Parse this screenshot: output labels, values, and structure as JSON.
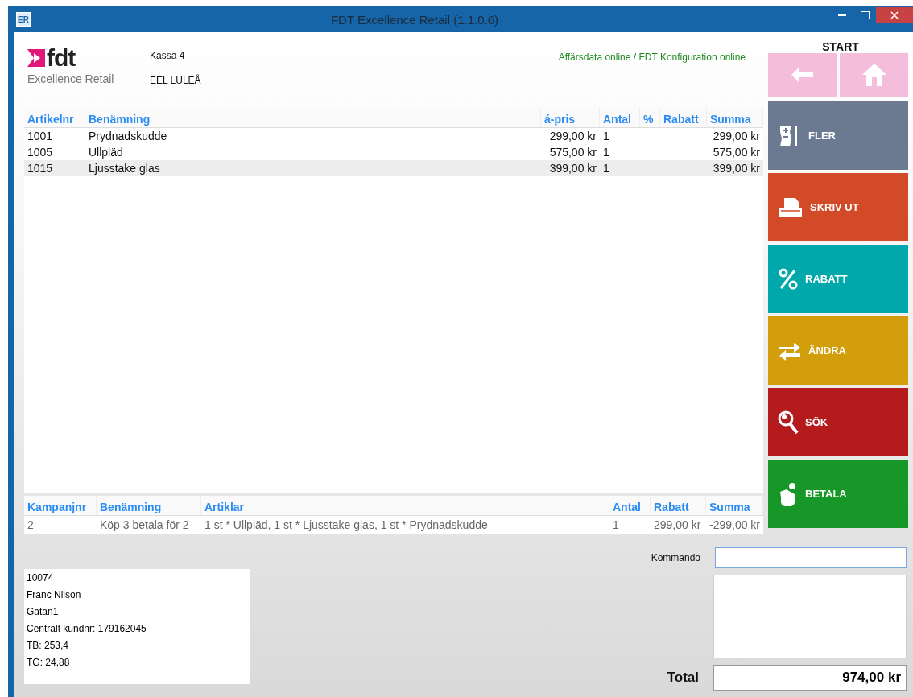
{
  "window": {
    "app_icon": "ER",
    "title": "FDT Excellence Retail (1.1.0.6)"
  },
  "header": {
    "logo": {
      "name": "fdt",
      "tagline": "Excellence Retail"
    },
    "register": "Kassa 4",
    "store": "EEL LULEÅ",
    "status": "Affärsdata online / FDT Konfiguration online"
  },
  "nav": {
    "title": "START",
    "buttons": [
      {
        "kind": "back"
      },
      {
        "kind": "home"
      }
    ]
  },
  "items": {
    "columns": [
      "Artikelnr",
      "Benämning",
      "á-pris",
      "Antal",
      "%",
      "Rabatt",
      "Summa"
    ],
    "rows": [
      {
        "selected": false,
        "cells": [
          "1001",
          "Prydnadskudde",
          "299,00 kr",
          "1",
          "",
          "",
          "299,00 kr"
        ]
      },
      {
        "selected": false,
        "cells": [
          "1005",
          "Ullpläd",
          "575,00 kr",
          "1",
          "",
          "",
          "575,00 kr"
        ]
      },
      {
        "selected": true,
        "cells": [
          "1015",
          "Ljusstake glas",
          "399,00 kr",
          "1",
          "",
          "",
          "399,00 kr"
        ]
      }
    ]
  },
  "campaigns": {
    "columns": [
      "Kampanjnr",
      "Benämning",
      "Artiklar",
      "Antal",
      "Rabatt",
      "Summa"
    ],
    "rows": [
      {
        "selected": false,
        "cells": [
          "2",
          "Köp 3 betala för 2",
          "1 st * Ullpläd, 1 st * Ljusstake glas, 1 st * Prydnadskudde",
          "1",
          "299,00 kr",
          "-299,00 kr"
        ]
      }
    ]
  },
  "actions": [
    {
      "kind": "more",
      "label": "FLER",
      "color": "#6c7a91"
    },
    {
      "kind": "print",
      "label": "SKRIV UT",
      "color": "#d24a27"
    },
    {
      "kind": "discount",
      "label": "RABATT",
      "color": "#00a8ac"
    },
    {
      "kind": "change",
      "label": "ÄNDRA",
      "color": "#d39e0b"
    },
    {
      "kind": "search",
      "label": "SÖK",
      "color": "#b51a1c"
    },
    {
      "kind": "pay",
      "label": "BETALA",
      "color": "#179727"
    }
  ],
  "command": {
    "label": "Kommando"
  },
  "customer": {
    "lines": [
      "10074",
      "Franc Nilson",
      "Gatan1",
      "Centralt kundnr: 179162045",
      "TB: 253,4",
      "TG: 24,88"
    ]
  },
  "total": {
    "label": "Total",
    "value": "974,00 kr"
  }
}
